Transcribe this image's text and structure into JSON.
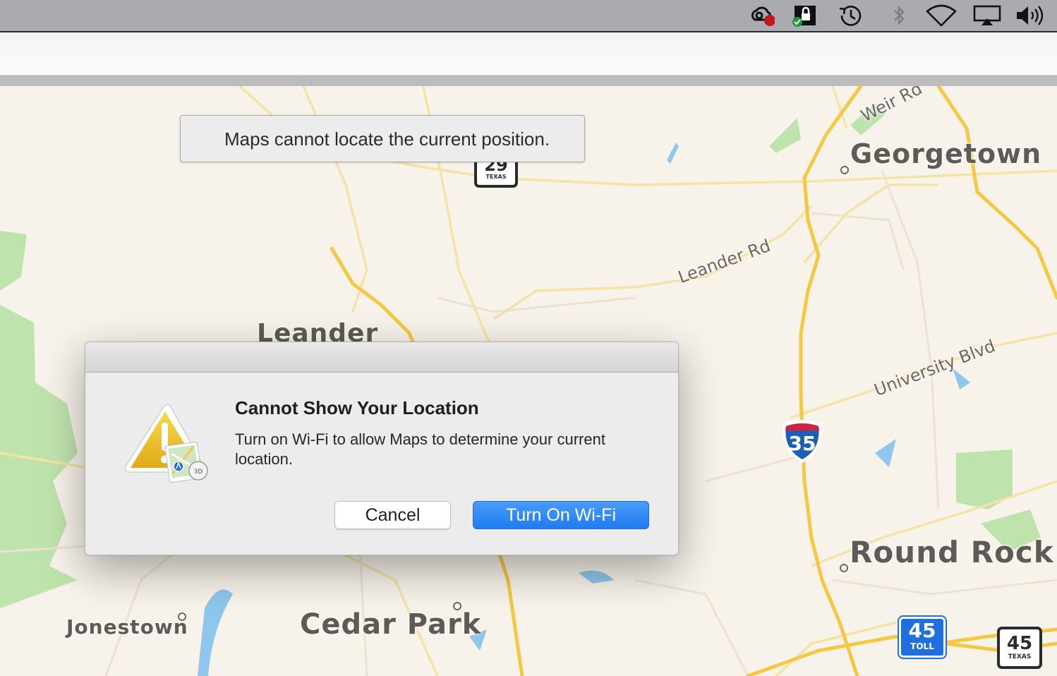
{
  "menubar": {
    "icons": [
      "creative-cloud-sync-icon",
      "vpn-lock-icon",
      "time-machine-icon",
      "bluetooth-icon",
      "wifi-icon",
      "airplay-icon",
      "volume-icon"
    ]
  },
  "banner": {
    "text": "Maps cannot locate the current position."
  },
  "map": {
    "places": {
      "georgetown": "Georgetown",
      "leander": "Leander",
      "round_rock": "Round Rock",
      "cedar_park": "Cedar Park",
      "jonestown": "Jonestown"
    },
    "roads": {
      "weir_rd": "Weir Rd",
      "leander_rd": "Leander Rd",
      "university_blvd": "University Blvd"
    },
    "shields": {
      "tx29_number": "29",
      "tx29_state": "TEXAS",
      "i35_number": "35",
      "toll45_number": "45",
      "toll45_label": "TOLL",
      "tx45_number": "45",
      "tx45_state": "TEXAS"
    }
  },
  "dialog": {
    "title": "Cannot Show Your Location",
    "message": "Turn on Wi-Fi to allow Maps to determine your current location.",
    "cancel_label": "Cancel",
    "confirm_label": "Turn On Wi-Fi",
    "icon_badge": "3D"
  },
  "colors": {
    "accent": "#1f7cf0",
    "map_background": "#f7f3ea",
    "highway": "#f5c842",
    "park": "#bfe3ad"
  }
}
